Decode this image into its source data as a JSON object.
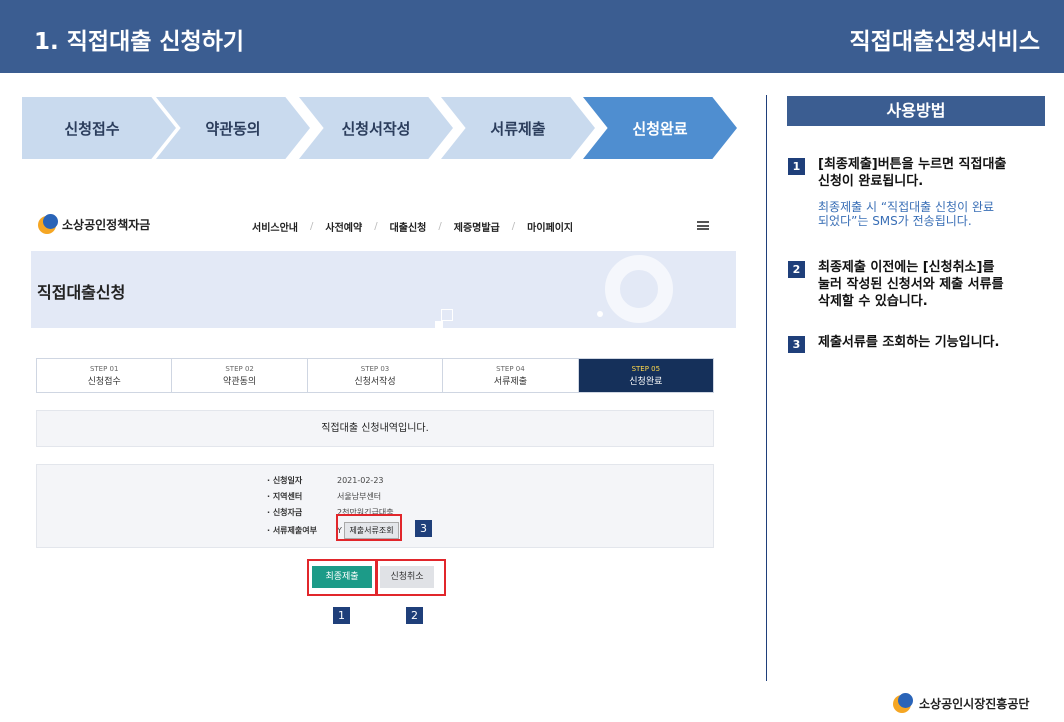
{
  "header": {
    "title": "1. 직접대출 신청하기",
    "service": "직접대출신청서비스"
  },
  "process_steps": [
    {
      "label": "신청접수"
    },
    {
      "label": "약관동의"
    },
    {
      "label": "신청서작성"
    },
    {
      "label": "서류제출"
    },
    {
      "label": "신청완료"
    }
  ],
  "site": {
    "logo_text": "소상공인정책자금",
    "nav": [
      "서비스안내",
      "사전예약",
      "대출신청",
      "제증명발급",
      "마이페이지"
    ],
    "nav_sep": "/",
    "page_title": "직접대출신청",
    "steps": [
      {
        "num": "STEP 01",
        "label": "신청접수"
      },
      {
        "num": "STEP 02",
        "label": "약관동의"
      },
      {
        "num": "STEP 03",
        "label": "신청서작성"
      },
      {
        "num": "STEP 04",
        "label": "서류제출"
      },
      {
        "num": "STEP 05",
        "label": "신청완료"
      }
    ],
    "notice": "직접대출 신청내역입니다.",
    "details": [
      {
        "label": "· 신청일자",
        "value": "2021-02-23"
      },
      {
        "label": "· 지역센터",
        "value": "서울남부센터"
      },
      {
        "label": "· 신청자금",
        "value": "2천만원긴급대출"
      },
      {
        "label": "· 서류제출여부",
        "value": "Y"
      }
    ],
    "check_docs_button": "제출서류조회",
    "final_submit_button": "최종제출",
    "cancel_button": "신청취소"
  },
  "callouts": [
    "1",
    "2",
    "3"
  ],
  "usage": {
    "title": "사용방법",
    "items": [
      {
        "num": "1",
        "text": "[최종제출]버튼을 누르면 직접대출\n신청이 완료됩니다.",
        "sub": "최종제출 시 “직접대출 신청이 완료\n되었다”는 SMS가 전송됩니다."
      },
      {
        "num": "2",
        "text": "최종제출 이전에는 [신청취소]를\n눌러 작성된 신청서와 제출 서류를\n삭제할 수 있습니다."
      },
      {
        "num": "3",
        "text": "제출서류를 조회하는 기능입니다."
      }
    ]
  },
  "footer": {
    "org": "소상공인시장진흥공단"
  },
  "colors": {
    "header": "#3b5d91",
    "chevron": "#c9daee",
    "chevron_active": "#4f8ed0",
    "step_active": "#15305a",
    "final_button": "#1c9b88",
    "highlight": "#e1262b"
  }
}
